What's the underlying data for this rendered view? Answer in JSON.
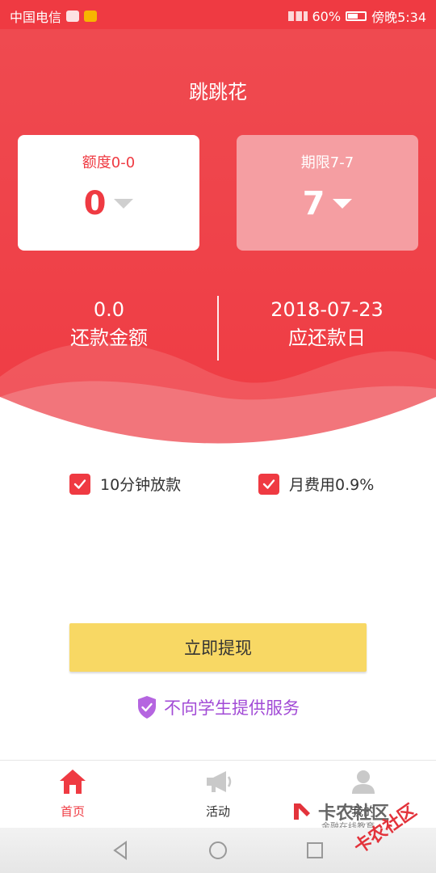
{
  "status_bar": {
    "carrier": "中国电信",
    "network": "4G",
    "battery": "60%",
    "time": "傍晚5:34"
  },
  "app": {
    "title": "跳跳花"
  },
  "loan": {
    "limit_label": "额度0-0",
    "limit_value": "0",
    "term_label": "期限7-7",
    "term_value": "7"
  },
  "repayment": {
    "amount_value": "0.0",
    "amount_label": "还款金额",
    "due_date_value": "2018-07-23",
    "due_date_label": "应还款日"
  },
  "options": {
    "fast_disbursement": "10分钟放款",
    "monthly_fee": "月费用0.9%"
  },
  "cta": {
    "withdraw_label": "立即提现"
  },
  "notice": {
    "text": "不向学生提供服务"
  },
  "bottom_nav": {
    "items": [
      {
        "label": "首页",
        "icon": "home-icon"
      },
      {
        "label": "活动",
        "icon": "megaphone-icon"
      },
      {
        "label": "我的",
        "icon": "user-icon"
      }
    ]
  },
  "watermark": {
    "brand": "卡农社区",
    "subtitle": "金融在线教育",
    "stamp": "卡农社区"
  },
  "colors": {
    "primary_red": "#ef3a42",
    "button_yellow": "#f8d864",
    "notice_purple": "#a24bd6"
  }
}
